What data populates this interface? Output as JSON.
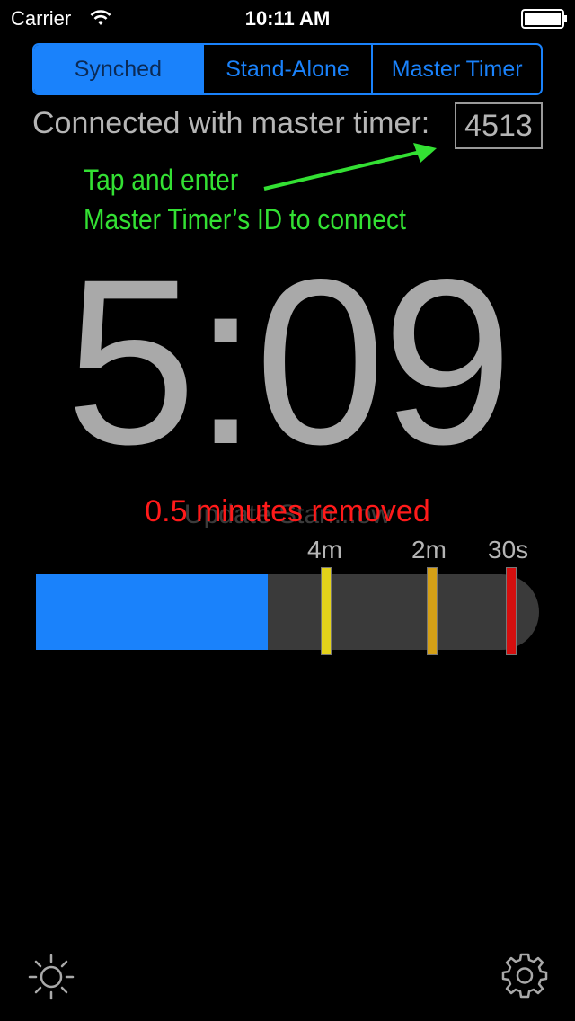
{
  "status_bar": {
    "carrier": "Carrier",
    "time": "10:11 AM",
    "icons": [
      "wifi-icon",
      "battery-icon"
    ]
  },
  "mode_tabs": [
    {
      "label": "Synched",
      "selected": true
    },
    {
      "label": "Stand-Alone",
      "selected": false
    },
    {
      "label": "Master Timer",
      "selected": false
    }
  ],
  "connection": {
    "label": "Connected with master timer:",
    "timer_id": "4513"
  },
  "hint": {
    "line1": "Tap and enter",
    "line2": "Master Timer’s ID to connect",
    "color": "#33e033"
  },
  "countdown": "5:09",
  "status_overlay": {
    "ghost_text": "Update Stan...ow",
    "removed_text": "0.5 minutes removed"
  },
  "progress": {
    "fraction_elapsed": 0.46,
    "markers": [
      {
        "label": "4m",
        "color": "#e3d21a"
      },
      {
        "label": "2m",
        "color": "#d4a017"
      },
      {
        "label": "30s",
        "color": "#d40f0f"
      }
    ]
  },
  "colors": {
    "accent": "#1a82fb",
    "time_text": "#a9a9a9",
    "alert": "#ff1a1a"
  },
  "toolbar_icons": [
    "brightness-icon",
    "gear-icon"
  ]
}
